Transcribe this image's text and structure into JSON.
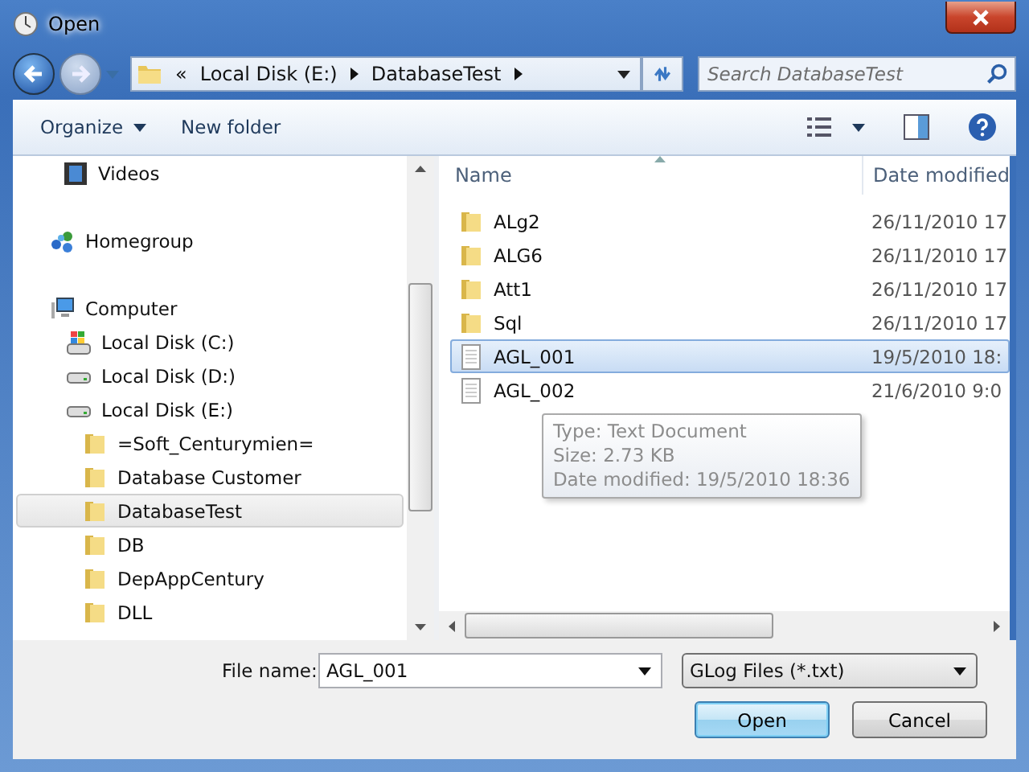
{
  "window": {
    "title": "Open"
  },
  "address": {
    "crumbs": [
      "«",
      "Local Disk (E:)",
      "DatabaseTest"
    ]
  },
  "search": {
    "placeholder": "Search DatabaseTest"
  },
  "toolbar": {
    "organize": "Organize",
    "new_folder": "New folder"
  },
  "nav": [
    {
      "label": "Videos",
      "kind": "video",
      "selected": false
    },
    {
      "label": "Homegroup",
      "kind": "homegroup",
      "selected": false
    },
    {
      "label": "Computer",
      "kind": "computer",
      "selected": false,
      "children": [
        {
          "label": "Local Disk (C:)",
          "kind": "system-drive",
          "selected": false
        },
        {
          "label": "Local Disk (D:)",
          "kind": "drive",
          "selected": false
        },
        {
          "label": "Local Disk (E:)",
          "kind": "drive",
          "selected": false,
          "children": [
            {
              "label": "=Soft_Centurymien=",
              "kind": "folder",
              "selected": false
            },
            {
              "label": "Database Customer",
              "kind": "folder",
              "selected": false
            },
            {
              "label": "DatabaseTest",
              "kind": "folder",
              "selected": true
            },
            {
              "label": "DB",
              "kind": "folder",
              "selected": false
            },
            {
              "label": "DepAppCentury",
              "kind": "folder",
              "selected": false
            },
            {
              "label": "DLL",
              "kind": "folder",
              "selected": false
            }
          ]
        }
      ]
    }
  ],
  "columns": [
    "Name",
    "Date modified"
  ],
  "files": [
    {
      "name": "ALg2",
      "date": "26/11/2010 17",
      "kind": "folder",
      "selected": false
    },
    {
      "name": "ALG6",
      "date": "26/11/2010 17",
      "kind": "folder",
      "selected": false
    },
    {
      "name": "Att1",
      "date": "26/11/2010 17",
      "kind": "folder",
      "selected": false
    },
    {
      "name": "Sql",
      "date": "26/11/2010 17",
      "kind": "folder",
      "selected": false
    },
    {
      "name": "AGL_001",
      "date": "19/5/2010 18:",
      "kind": "text",
      "selected": true
    },
    {
      "name": "AGL_002",
      "date": "21/6/2010 9:0",
      "kind": "text",
      "selected": false
    }
  ],
  "tooltip": [
    "Type: Text Document",
    "Size: 2.73 KB",
    "Date modified: 19/5/2010 18:36"
  ],
  "file_name": {
    "label": "File name:",
    "value": "AGL_001"
  },
  "file_type": {
    "value": "GLog Files (*.txt)"
  },
  "buttons": [
    "Open",
    "Cancel"
  ]
}
